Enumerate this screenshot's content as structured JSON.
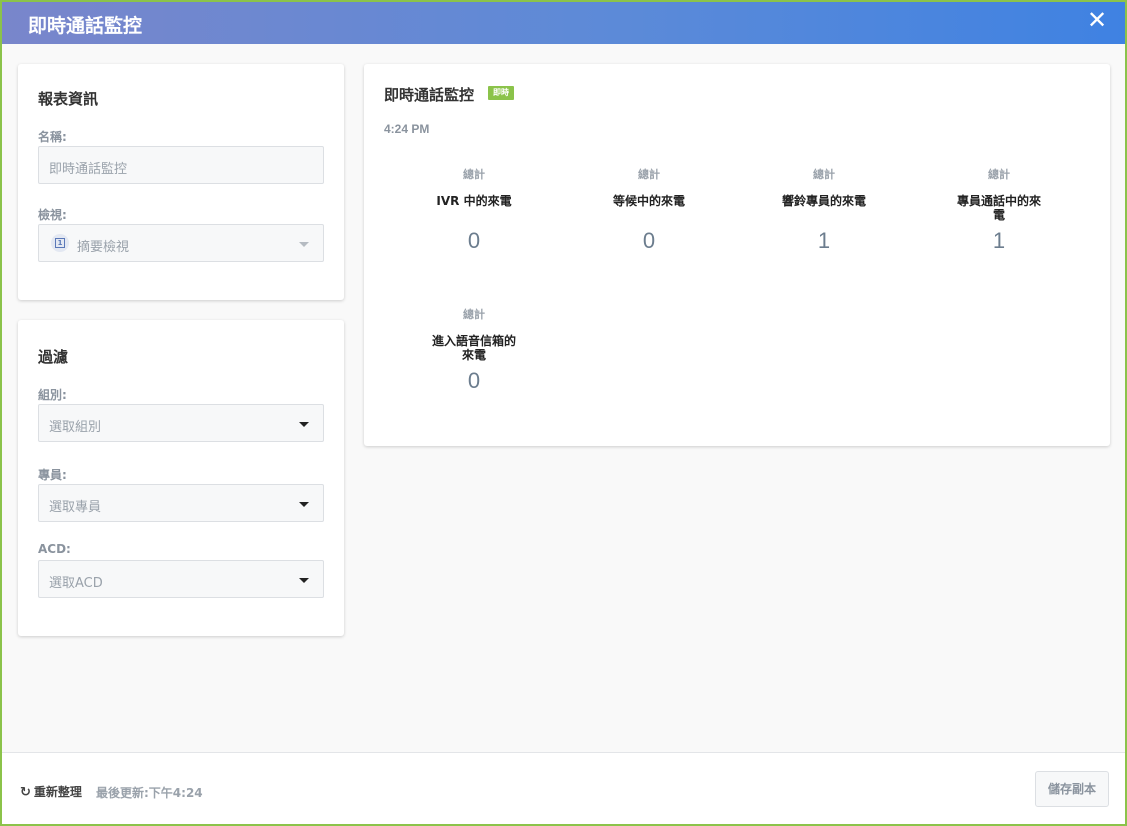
{
  "header": {
    "title": "即時通話監控",
    "close_glyph": "✕"
  },
  "report_info": {
    "title": "報表資訊",
    "name_label": "名稱:",
    "name_value": "即時通話監控",
    "view_label": "檢視:",
    "view_value": "摘要檢視",
    "view_icon": "summary-view-icon"
  },
  "filters": {
    "title": "過濾",
    "group_label": "組別:",
    "group_placeholder": "選取組別",
    "agent_label": "專員:",
    "agent_placeholder": "選取專員",
    "acd_label": "ACD:",
    "acd_placeholder": "選取ACD"
  },
  "monitor": {
    "title": "即時通話監控",
    "badge": "即時",
    "time": "4:24 PM",
    "metrics": [
      {
        "total": "總計",
        "label": "IVR 中的來電",
        "value": "0"
      },
      {
        "total": "總計",
        "label": "等候中的來電",
        "value": "0"
      },
      {
        "total": "總計",
        "label": "響鈴專員的來電",
        "value": "1"
      },
      {
        "total": "總計",
        "label": "專員通話中的來電",
        "value": "1"
      },
      {
        "total": "總計",
        "label": "進入語音信箱的來電",
        "value": "0"
      }
    ]
  },
  "footer": {
    "refresh_label": "重新整理",
    "last_update": "最後更新:下午4:24",
    "save_copy_label": "儲存副本"
  },
  "colors": {
    "accent_green": "#8bc34a",
    "header_gradient_start": "#7986cb",
    "header_gradient_end": "#3f82e2"
  }
}
